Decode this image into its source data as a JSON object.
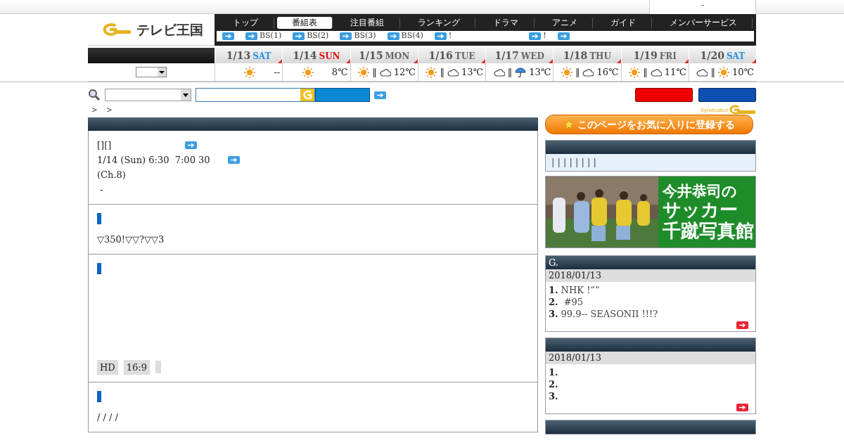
{
  "top_bar": {
    "text": "-"
  },
  "logo": {
    "text": "テレビ王国"
  },
  "nav": {
    "tabs": [
      {
        "label": "トップ",
        "selected": false
      },
      {
        "label": "番組表",
        "selected": true
      },
      {
        "label": "注目番組",
        "selected": false
      },
      {
        "label": "ランキング",
        "selected": false
      },
      {
        "label": "ドラマ",
        "selected": false
      },
      {
        "label": "アニメ",
        "selected": false
      },
      {
        "label": "ガイド",
        "selected": false
      },
      {
        "label": "メンバーサービス",
        "selected": false
      }
    ],
    "sublinks": [
      {
        "kind": "icon"
      },
      {
        "kind": "link",
        "label": "BS(1)"
      },
      {
        "kind": "link",
        "label": "BS(2)"
      },
      {
        "kind": "link",
        "label": "BS(3)"
      },
      {
        "kind": "link",
        "label": "BS(4)"
      },
      {
        "kind": "link",
        "label": "!"
      },
      {
        "kind": "link",
        "label": "!"
      },
      {
        "kind": "icon"
      }
    ]
  },
  "weather": {
    "days": [
      {
        "date": "1/13",
        "weekday": "SAT",
        "color": "#2a8ee0",
        "forecast": [
          {
            "kind": "sun"
          }
        ],
        "temp": "--"
      },
      {
        "date": "1/14",
        "weekday": "SUN",
        "color": "#e01010",
        "forecast": [
          {
            "kind": "sun"
          }
        ],
        "temp": "8℃"
      },
      {
        "date": "1/15",
        "weekday": "MON",
        "color": "#666666",
        "forecast": [
          {
            "kind": "sun"
          },
          {
            "kind": "text",
            "text": "‖"
          },
          {
            "kind": "cloud"
          }
        ],
        "temp": "12℃"
      },
      {
        "date": "1/16",
        "weekday": "TUE",
        "color": "#666666",
        "forecast": [
          {
            "kind": "sun"
          },
          {
            "kind": "text",
            "text": "‖"
          },
          {
            "kind": "cloud"
          }
        ],
        "temp": "13℃"
      },
      {
        "date": "1/17",
        "weekday": "WED",
        "color": "#666666",
        "forecast": [
          {
            "kind": "cloud"
          },
          {
            "kind": "text",
            "text": "‖"
          },
          {
            "kind": "umbrella"
          }
        ],
        "temp": "13℃"
      },
      {
        "date": "1/18",
        "weekday": "THU",
        "color": "#666666",
        "forecast": [
          {
            "kind": "sun"
          },
          {
            "kind": "text",
            "text": "‖"
          },
          {
            "kind": "cloud"
          }
        ],
        "temp": "16℃"
      },
      {
        "date": "1/19",
        "weekday": "FRI",
        "color": "#666666",
        "forecast": [
          {
            "kind": "sun"
          },
          {
            "kind": "text",
            "text": "‖"
          },
          {
            "kind": "cloud"
          }
        ],
        "temp": "11℃"
      },
      {
        "date": "1/20",
        "weekday": "SAT",
        "color": "#2a8ee0",
        "forecast": [
          {
            "kind": "cloud"
          },
          {
            "kind": "text",
            "text": "‖"
          },
          {
            "kind": "sun"
          }
        ],
        "temp": "10℃"
      }
    ]
  },
  "breadcrumb": [
    "＞",
    "＞"
  ],
  "syndicated": {
    "text": "Syndicated"
  },
  "program": {
    "title": "[][]",
    "time": "1/14 (Sun) 6:30  7:00 30",
    "channel": "(Ch.8)",
    "genre": " -"
  },
  "sections": [
    {
      "kind": "text",
      "text": "▽350!▽▽?▽▽3"
    },
    {
      "kind": "tags",
      "tags": [
        {
          "kind": "label",
          "label": "HD"
        },
        {
          "kind": "label",
          "label": "16:9"
        },
        {
          "kind": "blank"
        }
      ]
    },
    {
      "kind": "text",
      "text": "/ / / /"
    }
  ],
  "sidebar": {
    "favorite_button": "このページをお気に入りに登録する",
    "links_text": "| | | | | | | |",
    "banner": {
      "lines": [
        "今井恭司の",
        "サッカー",
        "千蹴写真館"
      ]
    },
    "rankings": [
      {
        "kind": "list",
        "title": "G.",
        "date": "2018/01/13",
        "items": [
          {
            "number": "1.",
            "text": "NHK !“”"
          },
          {
            "number": "2.",
            "text": " #95"
          },
          {
            "number": "3.",
            "text": "99.9-- SEASONII !!!?"
          }
        ]
      },
      {
        "kind": "list",
        "date": "2018/01/13",
        "items": [
          {
            "number": "1."
          },
          {
            "number": "2."
          },
          {
            "number": "3."
          }
        ]
      },
      {
        "kind": "header"
      }
    ]
  }
}
